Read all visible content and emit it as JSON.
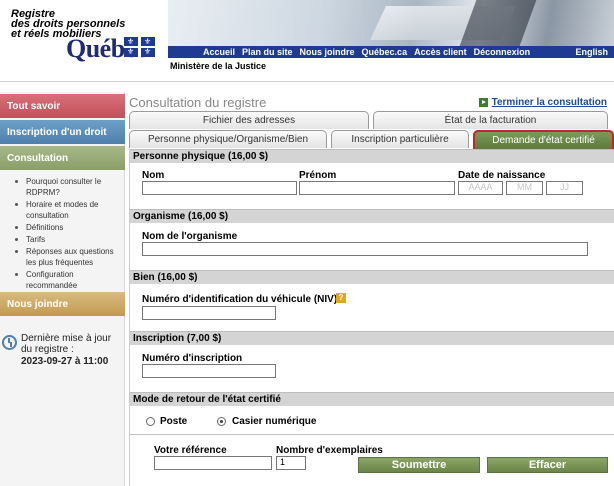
{
  "header": {
    "title_lines": [
      "Registre",
      "des droits personnels",
      "et réels mobiliers"
    ],
    "brand": "Québec",
    "ministry": "Ministère de la Justice",
    "nav": [
      "Accueil",
      "Plan du site",
      "Nous joindre",
      "Québec.ca",
      "Accès client",
      "Déconnexion"
    ],
    "language": "English"
  },
  "sidebar": {
    "tout_savoir": "Tout savoir",
    "inscription": "Inscription d'un droit",
    "consultation": "Consultation",
    "links": [
      "Pourquoi consulter le RDPRM?",
      "Horaire et modes de consultation",
      "Définitions",
      "Tarifs",
      "Réponses aux questions les plus fréquentes",
      "Configuration recommandée"
    ],
    "nous_joindre": "Nous joindre",
    "update_label": "Dernière mise à jour du registre :",
    "update_date": "2023-09-27 à 11:00"
  },
  "main": {
    "title": "Consultation du registre",
    "terminate": "Terminer la consultation",
    "tabs_row1": [
      "Fichier des adresses",
      "État de la facturation"
    ],
    "tabs_row2": [
      "Personne physique/Organisme/Bien",
      "Inscription particulière",
      "Demande d'état certifié"
    ],
    "active_tab": "Demande d'état certifié"
  },
  "form": {
    "personne": {
      "heading": "Personne physique (16,00 $)",
      "nom_label": "Nom",
      "prenom_label": "Prénom",
      "naissance_label": "Date de naissance",
      "year_ph": "AAAA",
      "month_ph": "MM",
      "day_ph": "JJ"
    },
    "organisme": {
      "heading": "Organisme (16,00 $)",
      "nom_label": "Nom de l'organisme"
    },
    "bien": {
      "heading": "Bien (16,00 $)",
      "niv_label": "Numéro d'identification du véhicule (NIV)",
      "help": "?"
    },
    "inscription": {
      "heading": "Inscription (7,00 $)",
      "num_label": "Numéro d'inscription"
    },
    "retour": {
      "heading": "Mode de retour de l'état certifié",
      "poste": "Poste",
      "casier": "Casier numérique",
      "selected": "Casier numérique"
    },
    "reference_label": "Votre référence",
    "exemplaires_label": "Nombre d'exemplaires",
    "exemplaires_value": "1",
    "submit": "Soumettre",
    "clear": "Effacer"
  },
  "colors": {
    "nav_blue": "#1f3a93",
    "active_tab_green": "#6a8647",
    "active_tab_border": "#c3252e",
    "link_blue": "#1f4aa0"
  }
}
